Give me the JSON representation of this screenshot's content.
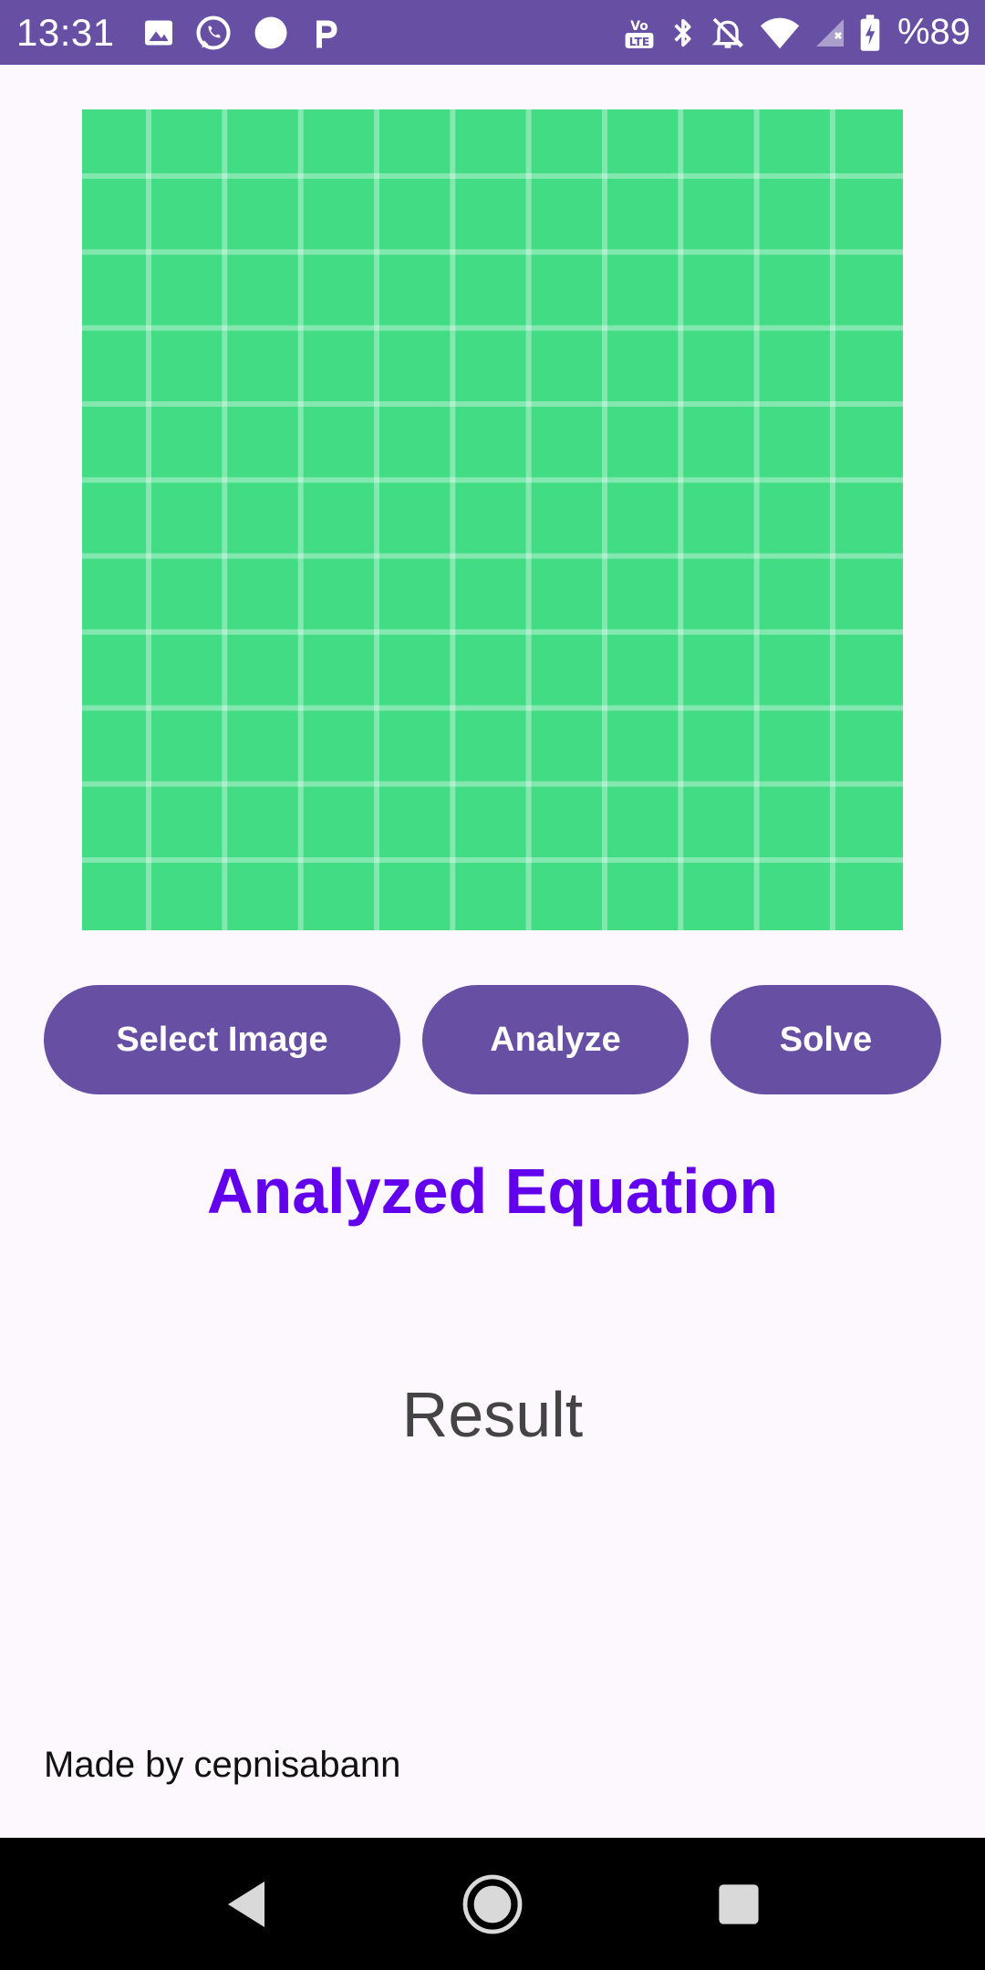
{
  "status_bar": {
    "time": "13:31",
    "battery_percent": "%89",
    "left_icons": [
      "gallery-icon",
      "whatsapp-icon",
      "circle-notification-icon",
      "p-app-icon"
    ],
    "right_icons": [
      "volte-icon",
      "bluetooth-icon",
      "mute-icon",
      "wifi-icon",
      "signal-icon",
      "battery-charging-icon"
    ],
    "color": "#6750a4"
  },
  "image_view": {
    "background_color": "#41dc84",
    "grid_color": "#ffffff"
  },
  "buttons": {
    "select_image": "Select Image",
    "analyze": "Analyze",
    "solve": "Solve",
    "color": "#6750a4"
  },
  "analyzed_title": "Analyzed Equation",
  "result": "Result",
  "footer": "Made by cepnisabann",
  "nav_bar": {
    "icons": [
      "back-icon",
      "home-icon",
      "recents-icon"
    ]
  },
  "accent_color": "#6200ee"
}
